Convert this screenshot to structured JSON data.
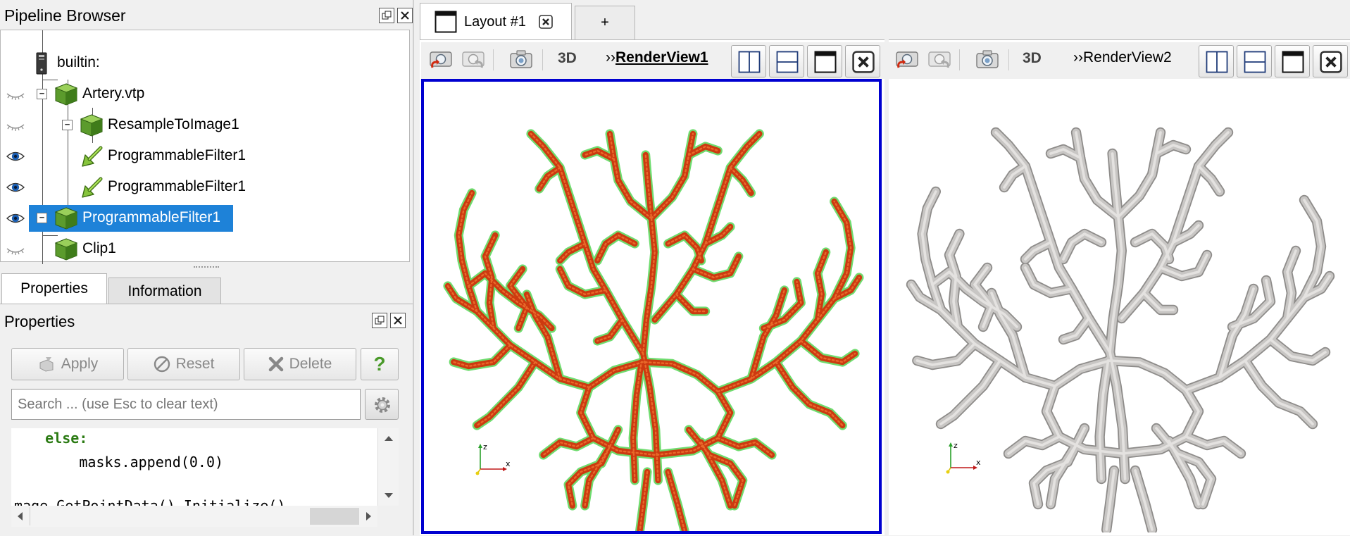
{
  "pipeline_browser": {
    "title": "Pipeline Browser",
    "items": [
      {
        "label": "builtin:"
      },
      {
        "label": "Artery.vtp"
      },
      {
        "label": "ResampleToImage1"
      },
      {
        "label": "ProgrammableFilter1"
      },
      {
        "label": "ProgrammableFilter1"
      },
      {
        "label": "ProgrammableFilter1"
      },
      {
        "label": "Clip1"
      }
    ]
  },
  "panel_tabs": [
    {
      "label": "Properties"
    },
    {
      "label": "Information"
    }
  ],
  "properties": {
    "title": "Properties",
    "apply_label": "Apply",
    "reset_label": "Reset",
    "delete_label": "Delete",
    "help_label": "?",
    "search_placeholder": "Search ... (use Esc to clear text)",
    "code_lines": [
      "    else:",
      "        masks.append(0.0)",
      "",
      "image.GetPointData().Initialize()"
    ]
  },
  "layout": {
    "tab_label": "Layout #1",
    "add_tab_label": "+"
  },
  "views": [
    {
      "mode_label": "3D",
      "name_prefix": "››",
      "name": "RenderView1",
      "active": true
    },
    {
      "mode_label": "3D",
      "name_prefix": "››",
      "name": "RenderView2",
      "active": false
    }
  ],
  "axes": {
    "z": "z",
    "x": "x"
  },
  "colors": {
    "selection": "#1e82d8",
    "active_view_border": "#0000d0",
    "vessel_core": "#cc3a10",
    "vessel_edge": "#6fdc6f",
    "vessel_surface": "#c8c6c4"
  }
}
